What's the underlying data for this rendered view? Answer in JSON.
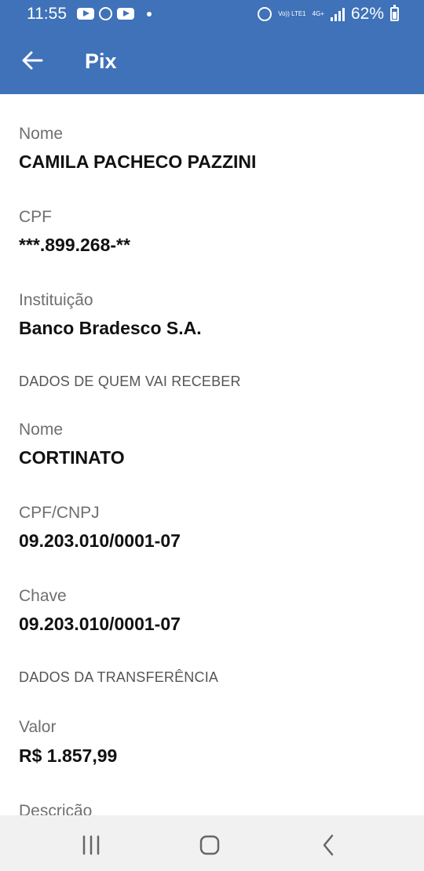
{
  "status_bar": {
    "time": "11:55",
    "network_volte": "Vo)) LTE1",
    "network_type": "4G+",
    "battery": "62%"
  },
  "header": {
    "title": "Pix",
    "back_icon": "arrow-left-icon"
  },
  "payer": {
    "name_label": "Nome",
    "name_value": "CAMILA PACHECO PAZZINI",
    "cpf_label": "CPF",
    "cpf_value": "***.899.268-**",
    "institution_label": "Instituição",
    "institution_value": "Banco Bradesco S.A."
  },
  "receiver": {
    "section_title": "DADOS DE QUEM VAI RECEBER",
    "name_label": "Nome",
    "name_value": "CORTINATO",
    "doc_label": "CPF/CNPJ",
    "doc_value": "09.203.010/0001-07",
    "key_label": "Chave",
    "key_value": "09.203.010/0001-07"
  },
  "transfer": {
    "section_title": "DADOS DA TRANSFERÊNCIA",
    "amount_label": "Valor",
    "amount_value": "R$ 1.857,99",
    "description_label": "Descrição"
  },
  "colors": {
    "brand": "#3f72b8",
    "label": "#6f6f6f",
    "value": "#111111",
    "nav_background": "#f1f1f1"
  }
}
